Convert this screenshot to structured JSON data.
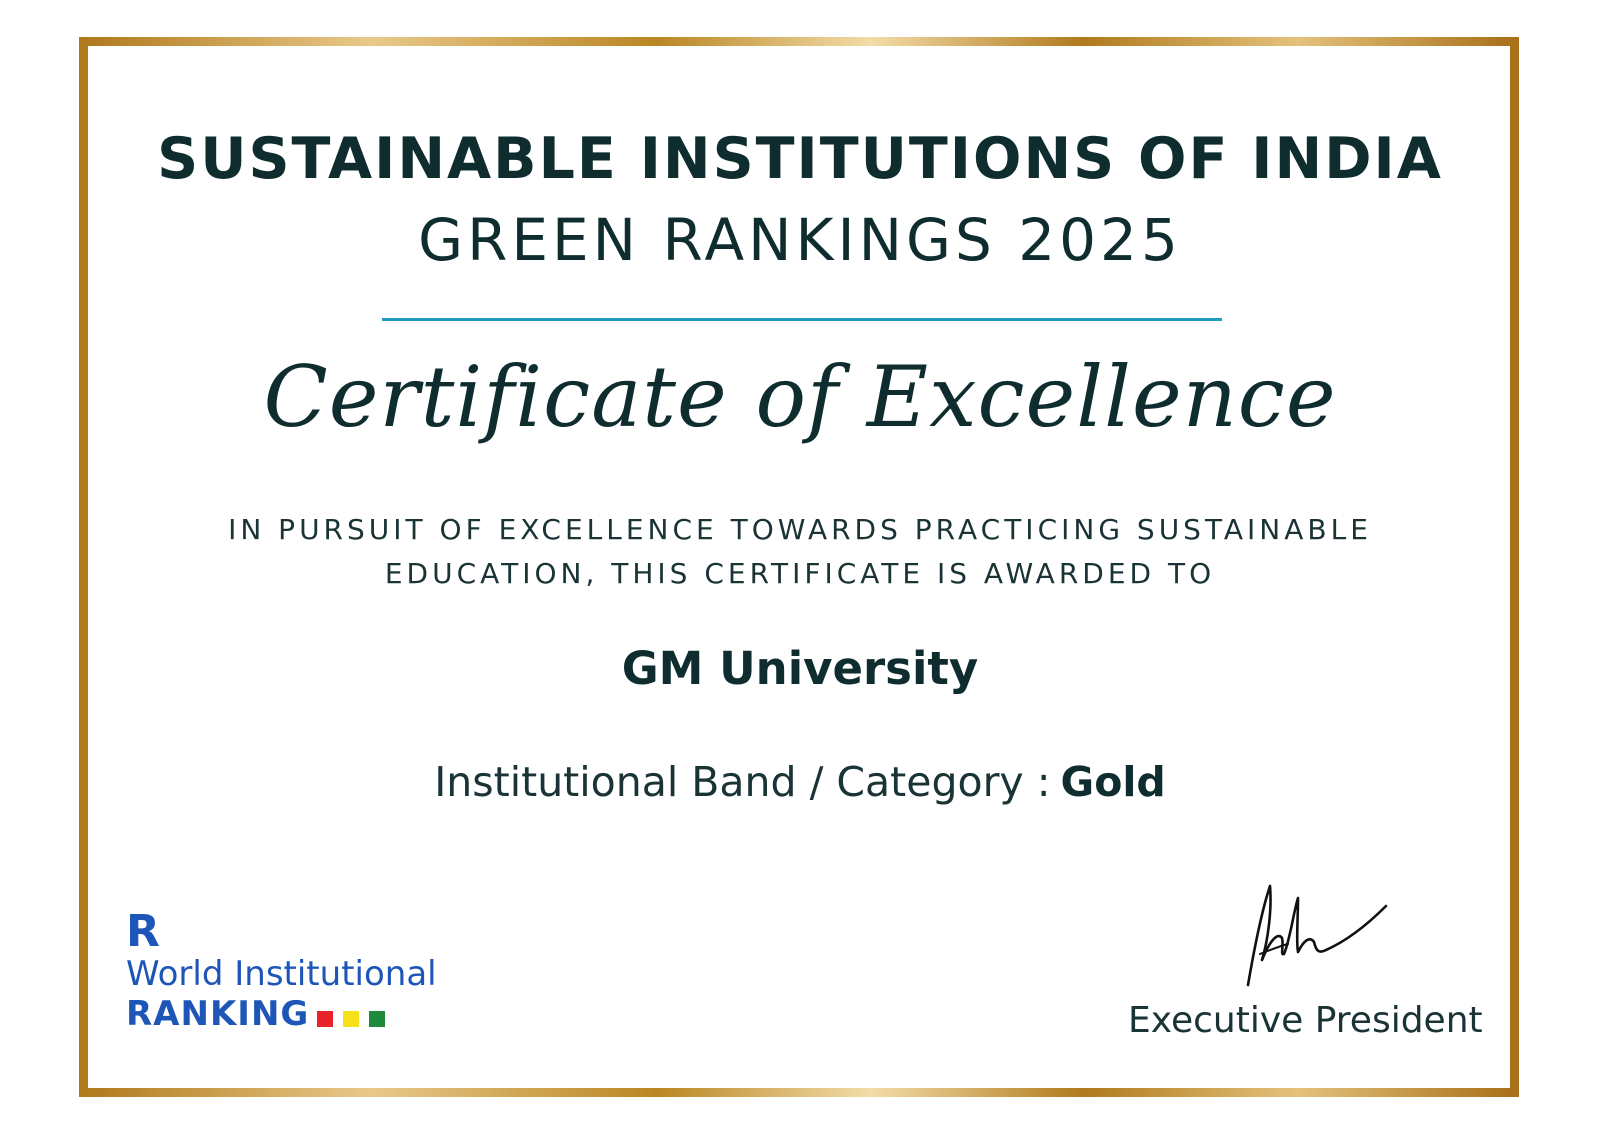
{
  "certificate": {
    "title_main": "SUSTAINABLE INSTITUTIONS OF INDIA",
    "title_sub": "GREEN RANKINGS 2025",
    "script_title": "Certificate of Excellence",
    "pursuit_line1": "IN PURSUIT OF EXCELLENCE TOWARDS PRACTICING SUSTAINABLE",
    "pursuit_line2": "EDUCATION, THIS CERTIFICATE IS AWARDED TO",
    "recipient": "GM University",
    "band_label": "Institutional Band / Category :",
    "band_value": "Gold",
    "signatory_title": "Executive President"
  },
  "logo": {
    "mark": "R",
    "line1": "World Institutional",
    "line2": "RANKING",
    "square_colors": [
      "#e8232a",
      "#f5e11b",
      "#1f8a3b"
    ]
  },
  "colors": {
    "text": "#0f2d2f",
    "divider": "#1f9cc4",
    "logo_blue": "#1e56b8",
    "border_gold": "#b98623"
  },
  "icons": {
    "signature": "handwritten-signature"
  }
}
